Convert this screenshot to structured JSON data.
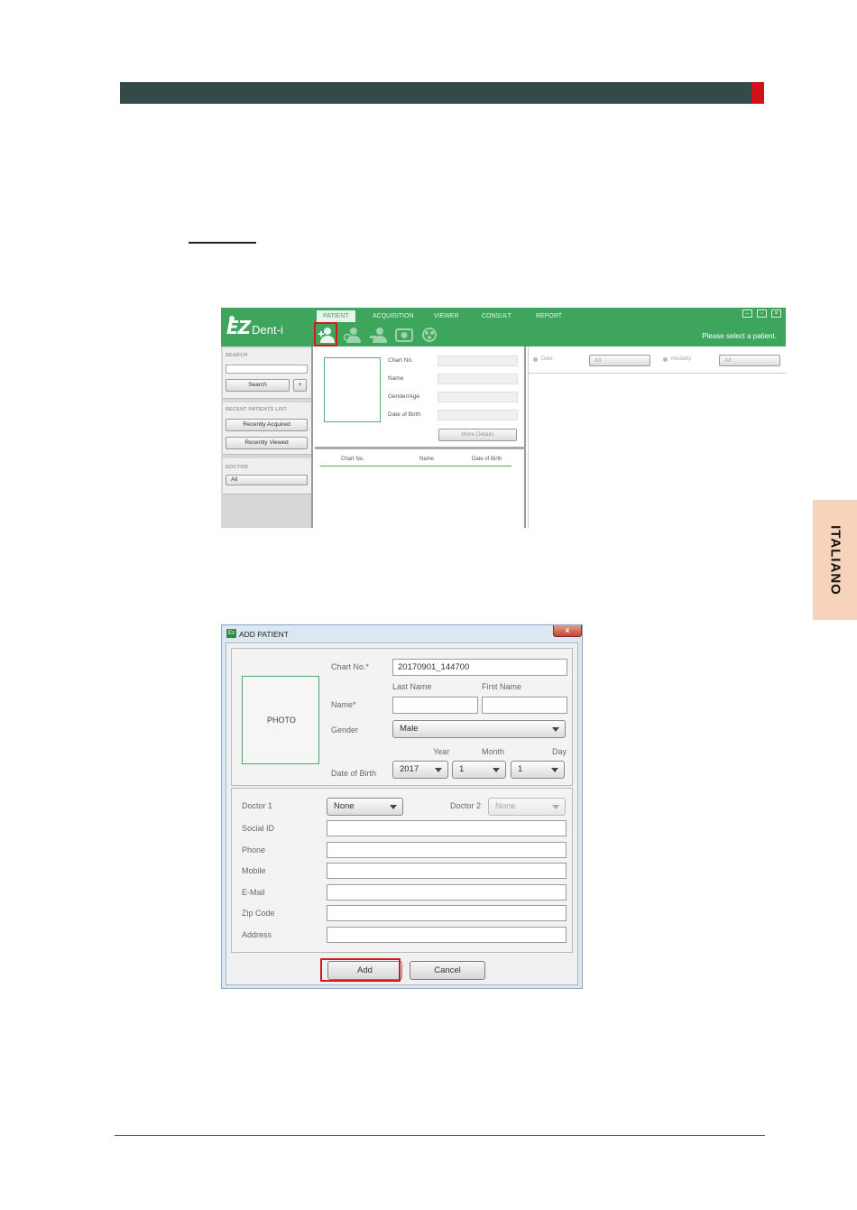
{
  "side_tab": {
    "label": "ITALIANO"
  },
  "app": {
    "logo": {
      "brand": "EZ",
      "product": "Dent-i"
    },
    "tabs": [
      "PATIENT",
      "ACQUISITION",
      "VIEWER",
      "CONSULT",
      "REPORT"
    ],
    "status_message": "Please select a patient.",
    "toolbar_icons": [
      "add-patient-icon",
      "edit-patient-icon",
      "delete-patient-icon",
      "import-image-icon",
      "share-icon"
    ],
    "sidebar": {
      "search_title": "SEARCH",
      "search_button": "Search",
      "plus_button": "+",
      "recent_title": "RECENT PATIENTS LIST",
      "recently_acquired": "Recently Acquired",
      "recently_viewed": "Recently Viewed",
      "doctor_title": "DOCTOR",
      "doctor_value": "All"
    },
    "patient_info": {
      "labels": [
        "Chart No.",
        "Name",
        "Gender/Age",
        "Date of Birth"
      ],
      "more_details": "More Details"
    },
    "patient_list": {
      "columns": [
        "Chart No.",
        "Name",
        "Date of Birth"
      ]
    },
    "filters": {
      "date_label": "Date",
      "date_value": "All",
      "modality_label": "Modality",
      "modality_value": "All"
    }
  },
  "dialog": {
    "title": "ADD PATIENT",
    "close": "x",
    "photo_label": "PHOTO",
    "chart_no_label": "Chart No.*",
    "chart_no_value": "20170901_144700",
    "last_name_label": "Last Name",
    "first_name_label": "First Name",
    "name_label": "Name*",
    "gender_label": "Gender",
    "gender_value": "Male",
    "year_label": "Year",
    "month_label": "Month",
    "day_label": "Day",
    "dob_label": "Date of Birth",
    "year_value": "2017",
    "month_value": "1",
    "day_value": "1",
    "doctor1_label": "Doctor 1",
    "doctor1_value": "None",
    "doctor2_label": "Doctor 2",
    "doctor2_value": "None",
    "social_id_label": "Social ID",
    "phone_label": "Phone",
    "mobile_label": "Mobile",
    "email_label": "E-Mail",
    "zip_label": "Zip Code",
    "address_label": "Address",
    "add_button": "Add",
    "cancel_button": "Cancel"
  }
}
